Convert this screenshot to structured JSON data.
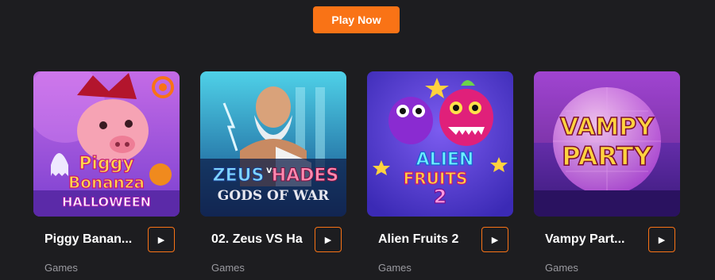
{
  "cta": {
    "label": "Play Now"
  },
  "games": [
    {
      "title": "Piggy Banan...",
      "art_text": [
        "Piggy",
        "Bonanza",
        "HALLOWEEN"
      ],
      "category": "Games",
      "play_icon": "▶"
    },
    {
      "title": "02. Zeus VS Ha",
      "art_text": [
        "ZEUS",
        "VS",
        "HADES",
        "GODS OF WAR"
      ],
      "category": "Games",
      "play_icon": "▶"
    },
    {
      "title": "Alien Fruits 2",
      "art_text": [
        "ALIEN",
        "FRUITS",
        "2"
      ],
      "category": "Games",
      "play_icon": "▶"
    },
    {
      "title": "Vampy Part...",
      "art_text": [
        "VAMPY",
        "PARTY"
      ],
      "category": "Games",
      "play_icon": "▶"
    }
  ],
  "colors": {
    "accent": "#f97316",
    "background": "#1d1d20"
  }
}
